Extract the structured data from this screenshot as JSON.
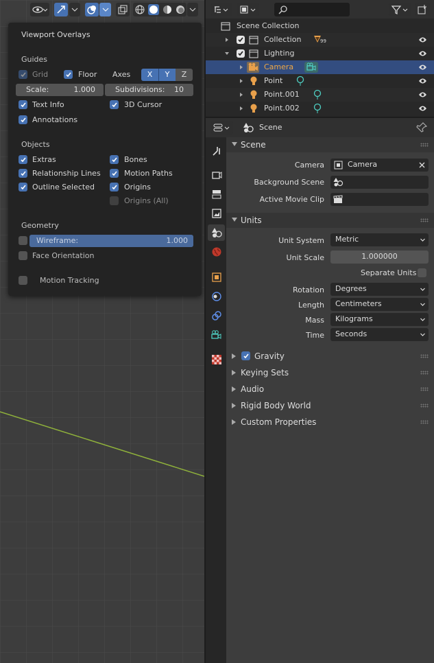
{
  "overlay": {
    "title": "Viewport Overlays",
    "guides": {
      "heading": "Guides",
      "grid": "Grid",
      "floor": "Floor",
      "axes": "Axes",
      "axis_x": "X",
      "axis_y": "Y",
      "axis_z": "Z",
      "scale_label": "Scale:",
      "scale_value": "1.000",
      "subdiv_label": "Subdivisions:",
      "subdiv_value": "10",
      "text_info": "Text Info",
      "cursor_3d": "3D Cursor",
      "annotations": "Annotations"
    },
    "objects": {
      "heading": "Objects",
      "extras": "Extras",
      "bones": "Bones",
      "relationship_lines": "Relationship Lines",
      "motion_paths": "Motion Paths",
      "outline_selected": "Outline Selected",
      "origins": "Origins",
      "origins_all": "Origins (All)"
    },
    "geometry": {
      "heading": "Geometry",
      "wireframe_label": "Wireframe:",
      "wireframe_value": "1.000",
      "face_orientation": "Face Orientation"
    },
    "motion_tracking": "Motion Tracking"
  },
  "outliner": {
    "root": "Scene Collection",
    "rows": [
      {
        "label": "Collection",
        "badge": "99"
      },
      {
        "label": "Lighting"
      },
      {
        "label": "Camera"
      },
      {
        "label": "Point"
      },
      {
        "label": "Point.001"
      },
      {
        "label": "Point.002"
      }
    ]
  },
  "properties": {
    "header_title": "Scene",
    "scene_panel": {
      "title": "Scene",
      "camera_label": "Camera",
      "camera_value": "Camera",
      "background_label": "Background Scene",
      "movie_clip_label": "Active Movie Clip"
    },
    "units_panel": {
      "title": "Units",
      "unit_system_label": "Unit System",
      "unit_system_value": "Metric",
      "unit_scale_label": "Unit Scale",
      "unit_scale_value": "1.000000",
      "separate_units": "Separate Units",
      "rotation_label": "Rotation",
      "rotation_value": "Degrees",
      "length_label": "Length",
      "length_value": "Centimeters",
      "mass_label": "Mass",
      "mass_value": "Kilograms",
      "time_label": "Time",
      "time_value": "Seconds"
    },
    "collapsed_panels": {
      "gravity": "Gravity",
      "keying_sets": "Keying Sets",
      "audio": "Audio",
      "rigid_body_world": "Rigid Body World",
      "custom_properties": "Custom Properties"
    }
  },
  "colors": {
    "accent": "#4772b3",
    "selected_row": "#334d80",
    "camera_orange": "#e8a04b"
  }
}
